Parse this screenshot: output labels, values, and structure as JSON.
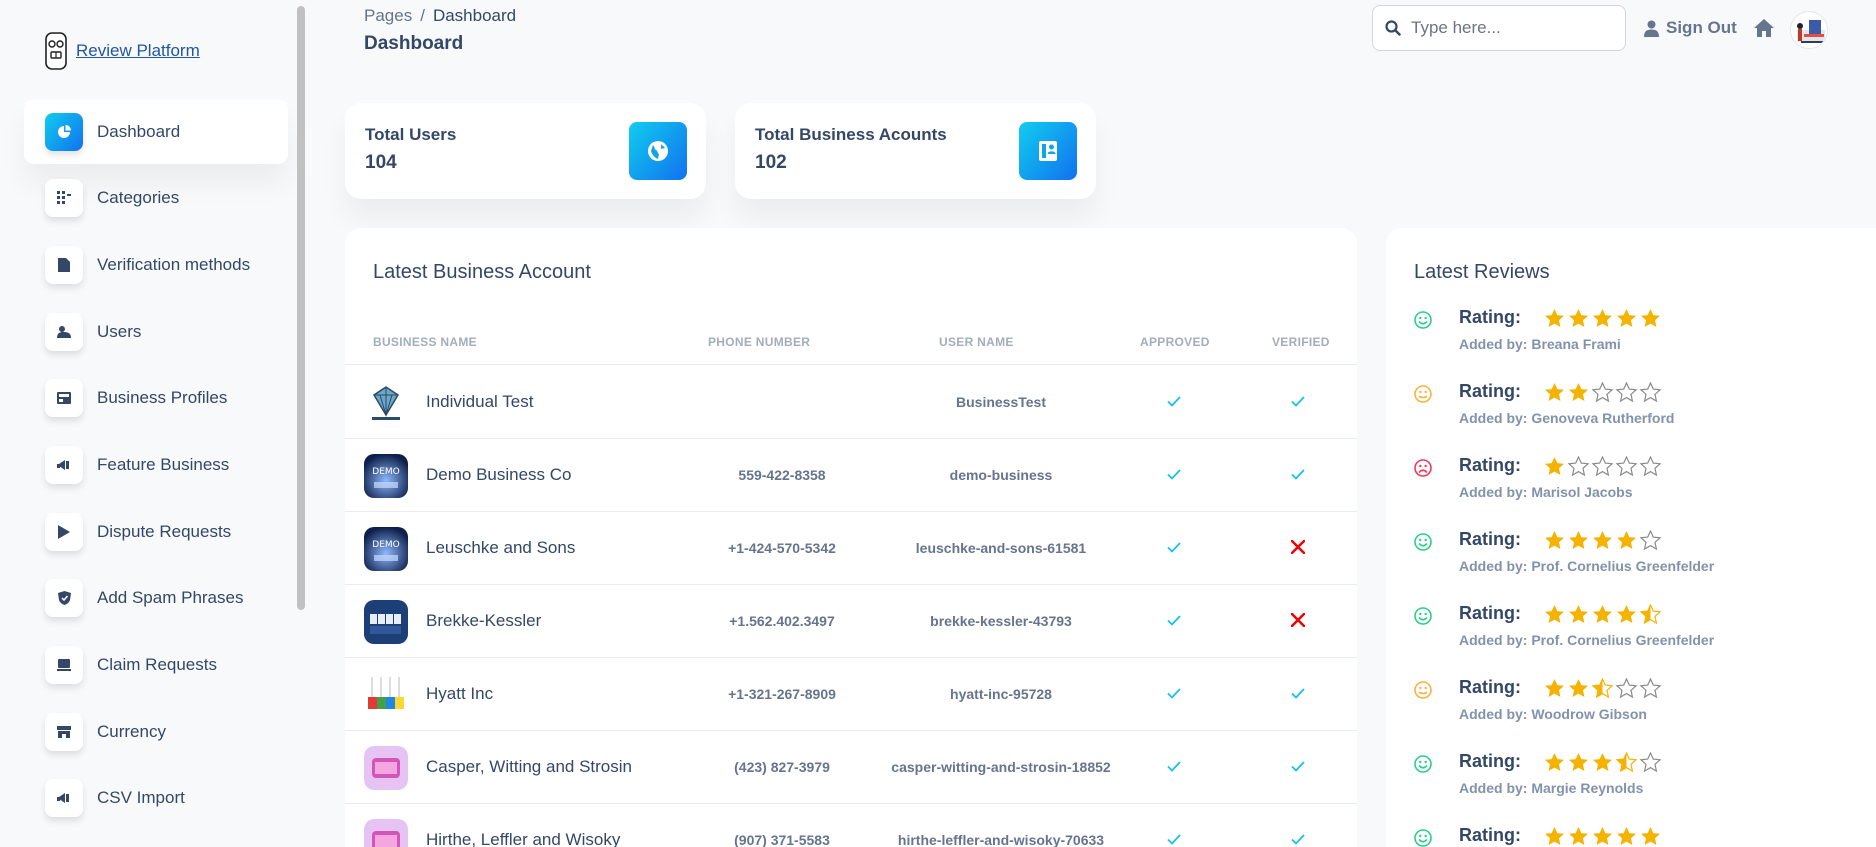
{
  "brand": {
    "name": "Review Platform"
  },
  "sidebar": {
    "items": [
      {
        "label": "Dashboard",
        "icon": "dashboard-icon",
        "active": true
      },
      {
        "label": "Categories",
        "icon": "categories-icon",
        "active": false
      },
      {
        "label": "Verification methods",
        "icon": "file-icon",
        "active": false
      },
      {
        "label": "Users",
        "icon": "users-icon",
        "active": false
      },
      {
        "label": "Business Profiles",
        "icon": "business-profiles-icon",
        "active": false
      },
      {
        "label": "Feature Business",
        "icon": "feature-icon",
        "active": false
      },
      {
        "label": "Dispute Requests",
        "icon": "play-icon",
        "active": false
      },
      {
        "label": "Add Spam Phrases",
        "icon": "shield-icon",
        "active": false
      },
      {
        "label": "Claim Requests",
        "icon": "laptop-icon",
        "active": false
      },
      {
        "label": "Currency",
        "icon": "shop-icon",
        "active": false
      },
      {
        "label": "CSV Import",
        "icon": "import-icon",
        "active": false
      }
    ]
  },
  "header": {
    "breadcrumb_root": "Pages",
    "breadcrumb_current": "Dashboard",
    "title": "Dashboard",
    "search_placeholder": "Type here...",
    "signout_label": "Sign Out"
  },
  "stats": {
    "users": {
      "label": "Total Users",
      "value": "104"
    },
    "business": {
      "label": "Total Business Acounts",
      "value": "102"
    }
  },
  "business_table": {
    "title": "Latest Business Account",
    "columns": [
      "Business Name",
      "Phone Number",
      "User Name",
      "Approved",
      "Verified"
    ],
    "rows": [
      {
        "name": "Individual Test",
        "phone": "",
        "user": "BusinessTest",
        "approved": true,
        "verified": true,
        "logo": "diamond"
      },
      {
        "name": "Demo Business Co",
        "phone": "559-422-8358",
        "user": "demo-business",
        "approved": true,
        "verified": true,
        "logo": "demo-blue"
      },
      {
        "name": "Leuschke and Sons",
        "phone": "+1-424-570-5342",
        "user": "leuschke-and-sons-61581",
        "approved": true,
        "verified": false,
        "logo": "demo-blue"
      },
      {
        "name": "Brekke-Kessler",
        "phone": "+1.562.402.3497",
        "user": "brekke-kessler-43793",
        "approved": true,
        "verified": false,
        "logo": "demo-tiles"
      },
      {
        "name": "Hyatt Inc",
        "phone": "+1-321-267-8909",
        "user": "hyatt-inc-95728",
        "approved": true,
        "verified": true,
        "logo": "demo-colored"
      },
      {
        "name": "Casper, Witting and Strosin",
        "phone": "(423) 827-3979",
        "user": "casper-witting-and-strosin-18852",
        "approved": true,
        "verified": true,
        "logo": "demo-pink"
      },
      {
        "name": "Hirthe, Leffler and Wisoky",
        "phone": "(907) 371-5583",
        "user": "hirthe-leffler-and-wisoky-70633",
        "approved": true,
        "verified": true,
        "logo": "demo-pink"
      }
    ]
  },
  "reviews": {
    "title": "Latest Reviews",
    "rating_label": "Rating:",
    "items": [
      {
        "rating": 5,
        "face": "happy",
        "by": "Added by: Breana Frami"
      },
      {
        "rating": 2,
        "face": "neutral",
        "by": "Added by: Genoveva Rutherford"
      },
      {
        "rating": 1,
        "face": "sad",
        "by": "Added by: Marisol Jacobs"
      },
      {
        "rating": 4,
        "face": "happy",
        "by": "Added by: Prof. Cornelius Greenfelder"
      },
      {
        "rating": 4.5,
        "face": "happy",
        "by": "Added by: Prof. Cornelius Greenfelder"
      },
      {
        "rating": 2.5,
        "face": "neutral",
        "by": "Added by: Woodrow Gibson"
      },
      {
        "rating": 3.5,
        "face": "happy",
        "by": "Added by: Margie Reynolds"
      },
      {
        "rating": 5,
        "face": "happy",
        "by": ""
      }
    ]
  },
  "colors": {
    "accent": "#11a3e8",
    "check": "#17c1e8",
    "cross": "#ea0606",
    "star": "#f5b301",
    "happy": "#2dce89",
    "neutral": "#fbb140",
    "sad": "#f5365c"
  }
}
